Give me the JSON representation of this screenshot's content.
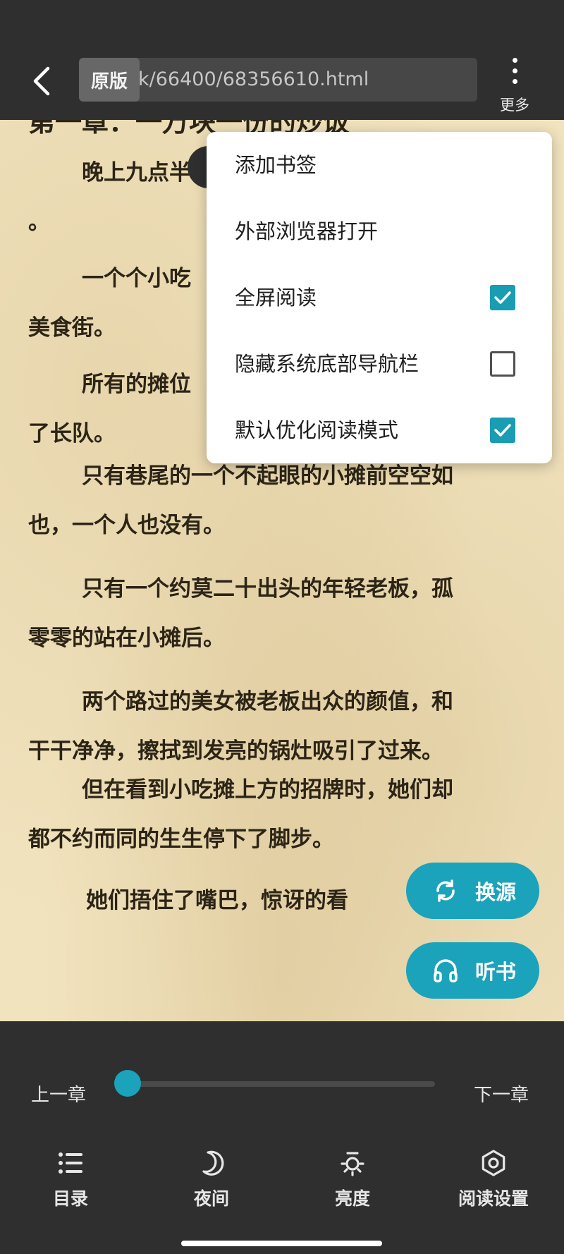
{
  "topbar": {
    "badge": "原版",
    "url": "k/66400/68356610.html",
    "more_label": "更多"
  },
  "reader": {
    "chapter_title": "第一章：一万块一份的炒饭",
    "paragraphs": [
      {
        "line1": "晚上九点半",
        "line2": "。"
      },
      {
        "line1": "一个个小吃",
        "line2": "美食街。"
      },
      {
        "line1": "所有的摊位",
        "line2": "了长队。"
      },
      {
        "line1": "只有巷尾的一个不起眼的小摊前空空如",
        "line2": "也，一个人也没有。"
      },
      {
        "line1": "只有一个约莫二十出头的年轻老板，孤",
        "line2": "零零的站在小摊后。"
      },
      {
        "line1": "两个路过的美女被老板出众的颜值，和",
        "line2": "干干净净，擦拭到发亮的锅灶吸引了过来。"
      },
      {
        "line1": "但在看到小吃摊上方的招牌时，她们却",
        "line2": "都不约而同的生生停下了脚步。"
      },
      {
        "line1": "她们捂住了嘴巴，惊讶的看"
      }
    ]
  },
  "menu": {
    "items": [
      {
        "label": "添加书签"
      },
      {
        "label": "外部浏览器打开"
      },
      {
        "label": "全屏阅读",
        "checked": true
      },
      {
        "label": "隐藏系统底部导航栏",
        "checked": false
      },
      {
        "label": "默认优化阅读模式",
        "checked": true
      }
    ]
  },
  "fabs": {
    "change_source": "换源",
    "listen": "听书"
  },
  "bottom": {
    "prev_chapter": "上一章",
    "next_chapter": "下一章",
    "progress": 0.0,
    "tabs": [
      {
        "label": "目录",
        "icon": "list-icon"
      },
      {
        "label": "夜间",
        "icon": "moon-icon"
      },
      {
        "label": "亮度",
        "icon": "brightness-icon"
      },
      {
        "label": "阅读设置",
        "icon": "gear-icon"
      }
    ]
  },
  "colors": {
    "accent": "#1aa3bb",
    "paper": "#f1e3be",
    "bar": "#2f2f2f"
  }
}
